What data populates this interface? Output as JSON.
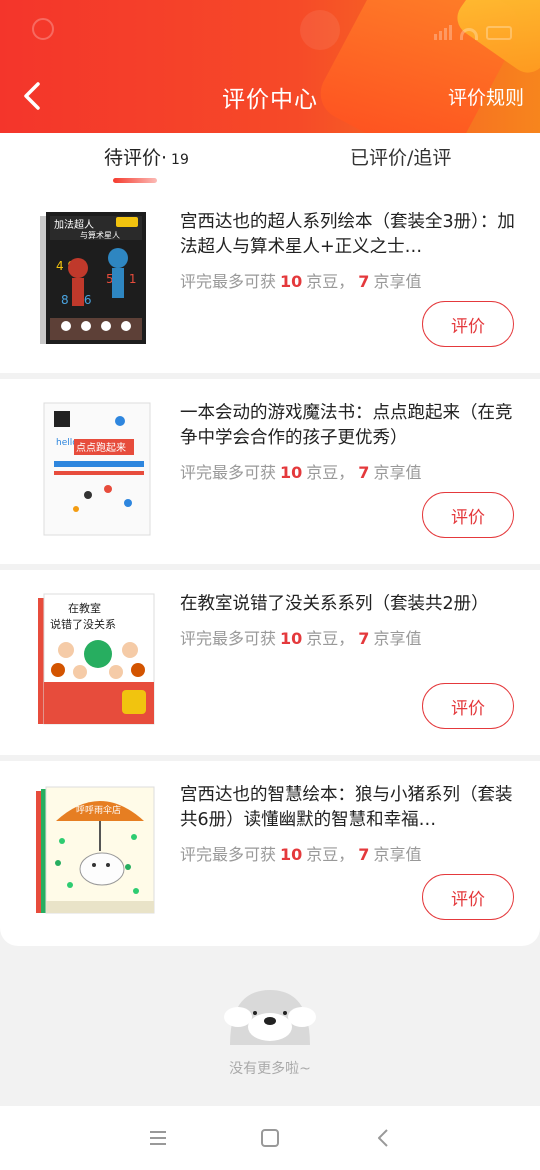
{
  "header": {
    "title": "评价中心",
    "rules_label": "评价规则",
    "back_icon": "chevron-left-icon"
  },
  "tabs": [
    {
      "label": "待评价·",
      "count": "19",
      "active": true
    },
    {
      "label": "已评价/追评",
      "active": false
    }
  ],
  "reward_text": {
    "prefix": "评完最多可获",
    "bean_count": "10",
    "bean_unit": "京豆，",
    "value_count": "7",
    "value_unit": "京享值"
  },
  "items": [
    {
      "name": "宫西达也的超人系列绘本（套装全3册）：加法超人与算术星人+正义之士…",
      "cover_title": "加法超人与算术星人",
      "button": "评价"
    },
    {
      "name": "一本会动的游戏魔法书：点点跑起来（在竞争中学会合作的孩子更优秀）",
      "cover_title": "点点跑起来",
      "button": "评价"
    },
    {
      "name": "在教室说错了没关系系列（套装共2册）",
      "cover_title": "在教室说错了没关系",
      "button": "评价"
    },
    {
      "name": "宫西达也的智慧绘本：狼与小猪系列（套装共6册）读懂幽默的智慧和幸福…",
      "cover_title": "呼呼雨伞店",
      "button": "评价"
    }
  ],
  "footer": {
    "no_more": "没有更多啦~"
  },
  "colors": {
    "brand_red": "#e4393c",
    "header_start": "#f4352b",
    "header_end": "#f7851d"
  }
}
